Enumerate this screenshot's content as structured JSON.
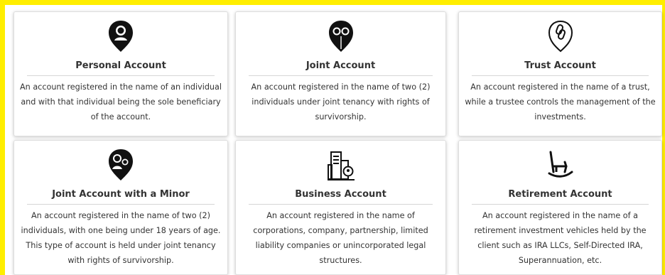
{
  "cards": [
    {
      "icon": "person-pin-icon",
      "title": "Personal Account",
      "description": "An account registered in the name of an individual and with that individual being the sole beneficiary of the account."
    },
    {
      "icon": "two-people-pin-icon",
      "title": "Joint Account",
      "description": "An account registered in the name of two (2) individuals under joint tenancy with rights of survivorship."
    },
    {
      "icon": "chain-link-pin-icon",
      "title": "Trust Account",
      "description": "An account registered in the name of a trust, while a trustee controls the management of the investments."
    },
    {
      "icon": "adult-child-pin-icon",
      "title": "Joint Account with a Minor",
      "description": "An account registered in the name of two (2) individuals, with one being under 18 years of age. This type of account is held under joint tenancy with rights of survivorship."
    },
    {
      "icon": "building-location-icon",
      "title": "Business Account",
      "description": "An account registered in the name of corporations, company, partnership, limited liability companies or unincorporated legal structures."
    },
    {
      "icon": "rocking-chair-icon",
      "title": "Retirement Account",
      "description": "An account registered in the name of a retirement investment vehicles held by the client such as IRA LLCs, Self-Directed IRA, Superannuation, etc."
    }
  ],
  "colors": {
    "frame": "#ffee00",
    "text": "#333333",
    "divider": "#d6d6d6"
  }
}
